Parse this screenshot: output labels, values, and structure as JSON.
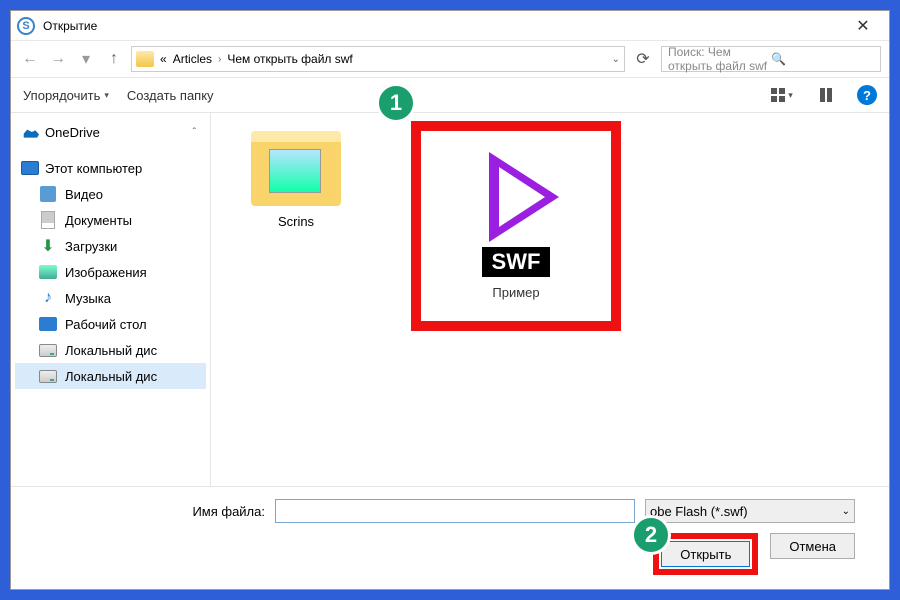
{
  "title": "Открытие",
  "breadcrumb": {
    "prefix": "«",
    "parts": [
      "Articles",
      "Чем открыть файл swf"
    ]
  },
  "search": {
    "placeholder": "Поиск: Чем открыть файл swf"
  },
  "toolbar": {
    "organize": "Упорядочить",
    "new_folder": "Создать папку"
  },
  "sidebar": {
    "onedrive": "OneDrive",
    "this_pc": "Этот компьютер",
    "items": [
      "Видео",
      "Документы",
      "Загрузки",
      "Изображения",
      "Музыка",
      "Рабочий стол",
      "Локальный дис",
      "Локальный дис"
    ]
  },
  "content": {
    "folder_name": "Scrins",
    "swf_badge": "SWF",
    "swf_label": "Пример"
  },
  "footer": {
    "filename_label": "Имя файла:",
    "filename_value": "",
    "filetype": "obe Flash (*.swf)",
    "open": "Открыть",
    "cancel": "Отмена"
  },
  "badges": {
    "one": "1",
    "two": "2"
  }
}
